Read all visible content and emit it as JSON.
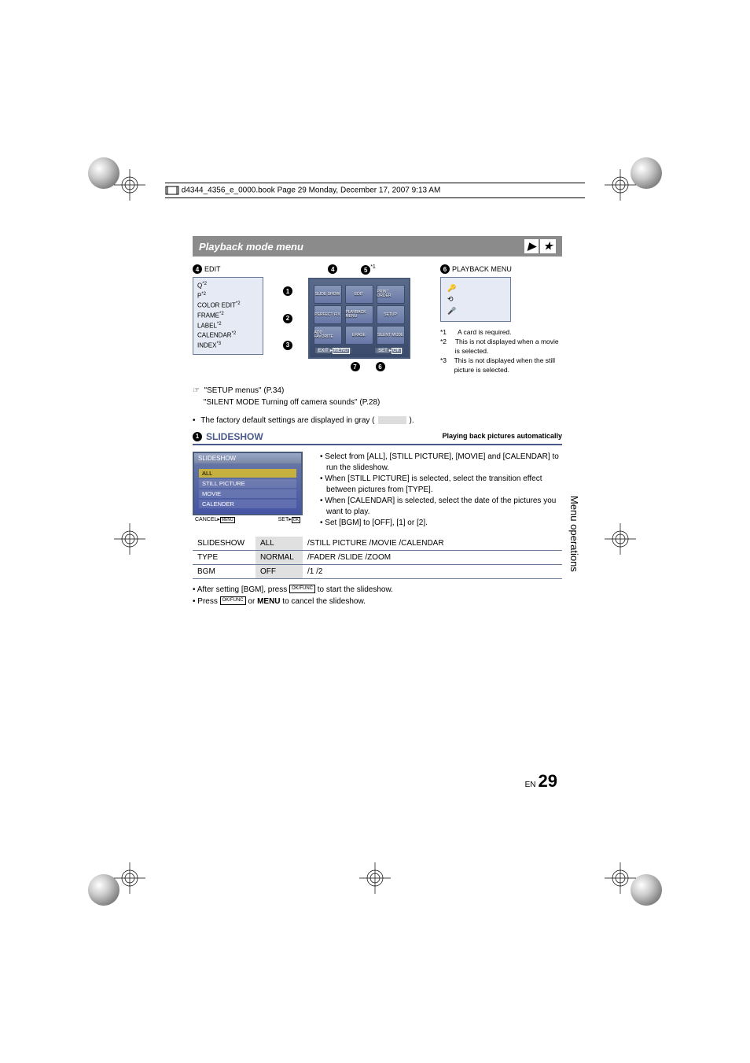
{
  "header_text": "d4344_4356_e_0000.book  Page 29  Monday, December 17, 2007  9:13 AM",
  "section_title": "Playback mode menu",
  "edit": {
    "label": "EDIT",
    "callout_num": "4",
    "items": [
      "Q",
      "P",
      "COLOR EDIT",
      "FRAME",
      "LABEL",
      "CALENDAR",
      "INDEX"
    ],
    "sups": [
      "*2",
      "*2",
      "*2",
      "*2",
      "*2",
      "*2",
      "*3"
    ]
  },
  "menu_grid": {
    "top_left_num": "4",
    "top_right_num": "5",
    "top_right_sup": "*1",
    "left_nums": [
      "1",
      "2",
      "3"
    ],
    "bottom_nums": [
      "7",
      "6"
    ],
    "cells": [
      [
        "SLIDE SHOW",
        "EDIT",
        "PRINT ORDER"
      ],
      [
        "PERFECT FIX",
        "PLAYBACK MENU",
        "SETUP"
      ],
      [
        "ADD FAVORITE",
        "ERASE",
        "SILENT MODE"
      ]
    ],
    "exit": "EXIT",
    "exit_btn": "MENU",
    "set": "SET",
    "ok": "OK"
  },
  "playback_menu": {
    "label": "PLAYBACK MENU",
    "callout_num": "6"
  },
  "footnotes": [
    {
      "k": "*1",
      "v": "A card is required."
    },
    {
      "k": "*2",
      "v": "This is not displayed when a movie is selected."
    },
    {
      "k": "*3",
      "v": "This is not displayed when the still picture is selected."
    }
  ],
  "refs": {
    "a": "\"SETUP menus\" (P.34)",
    "b": "\"SILENT MODE    Turning off camera sounds\" (P.28)"
  },
  "factory_note": "The factory default settings are displayed in gray (",
  "factory_note_end": ").",
  "slideshow": {
    "num": "1",
    "title": "SLIDESHOW",
    "subtitle": "Playing back pictures automatically",
    "lcd_title": "SLIDESHOW",
    "lcd_items": [
      "ALL",
      "STILL PICTURE",
      "MOVIE",
      "CALENDER"
    ],
    "lcd_cancel": "CANCEL",
    "lcd_menu": "MENU",
    "lcd_set": "SET",
    "lcd_ok": "OK",
    "bullets": [
      "Select from [ALL], [STILL PICTURE], [MOVIE] and [CALENDAR] to run the slideshow.",
      "When [STILL PICTURE] is selected, select the transition effect between pictures from [TYPE].",
      "When [CALENDAR] is selected, select the date of the pictures you want to play.",
      "Set [BGM] to [OFF], [1] or [2]."
    ]
  },
  "settings_table": [
    {
      "k": "SLIDESHOW",
      "d": "ALL",
      "v": " /STILL PICTURE /MOVIE /CALENDAR"
    },
    {
      "k": "TYPE",
      "d": "NORMAL",
      "v": " /FADER /SLIDE /ZOOM"
    },
    {
      "k": "BGM",
      "d": "OFF",
      "v": " /1            /2"
    }
  ],
  "after_notes": {
    "a_pre": "After setting [BGM], press ",
    "a_btn": "OK/FUNC",
    "a_post": " to start the slideshow.",
    "b_pre": "Press ",
    "b_btn": "OK/FUNC",
    "b_mid": " or ",
    "b_menu": "MENU",
    "b_post": " to cancel the slideshow."
  },
  "side_text": "Menu operations",
  "page": {
    "lang": "EN",
    "num": "29"
  }
}
